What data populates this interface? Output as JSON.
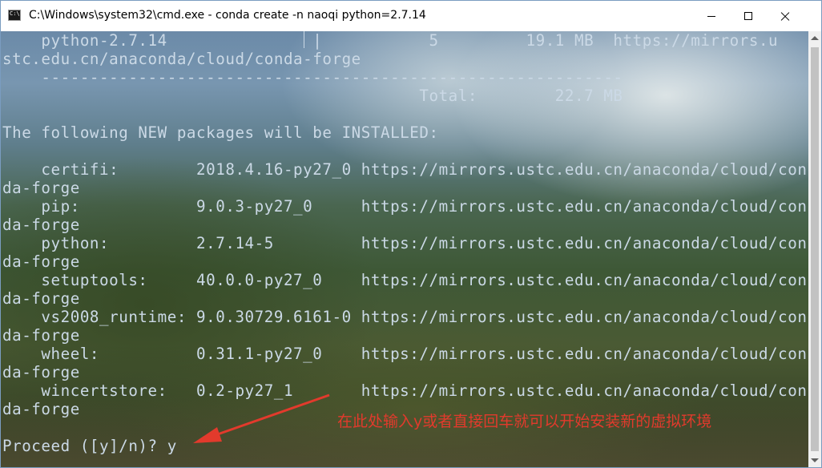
{
  "window": {
    "title": "C:\\Windows\\system32\\cmd.exe - conda  create -n naoqi python=2.7.14",
    "icon_label": "C:\\",
    "icons": [
      "cmd-app-icon",
      "minimize-icon",
      "maximize-icon",
      "close-icon"
    ]
  },
  "console": {
    "lines": [
      "    python-2.7.14               |           5         19.1 MB  https://mirrors.u",
      "stc.edu.cn/anaconda/cloud/conda-forge",
      "    ------------------------------------------------------------",
      "                                           Total:        22.7 MB",
      "",
      "The following NEW packages will be INSTALLED:",
      "",
      "    certifi:        2018.4.16-py27_0 https://mirrors.ustc.edu.cn/anaconda/cloud/con",
      "da-forge",
      "    pip:            9.0.3-py27_0     https://mirrors.ustc.edu.cn/anaconda/cloud/con",
      "da-forge",
      "    python:         2.7.14-5         https://mirrors.ustc.edu.cn/anaconda/cloud/con",
      "da-forge",
      "    setuptools:     40.0.0-py27_0    https://mirrors.ustc.edu.cn/anaconda/cloud/con",
      "da-forge",
      "    vs2008_runtime: 9.0.30729.6161-0 https://mirrors.ustc.edu.cn/anaconda/cloud/con",
      "da-forge",
      "    wheel:          0.31.1-py27_0    https://mirrors.ustc.edu.cn/anaconda/cloud/con",
      "da-forge",
      "    wincertstore:   0.2-py27_1       https://mirrors.ustc.edu.cn/anaconda/cloud/con",
      "da-forge",
      "",
      "Proceed ([y]/n)? y"
    ]
  },
  "annotation": {
    "text": "在此处输入y或者直接回车就可以开始安装新的虚拟环境",
    "color": "#e23a2c"
  },
  "colors": {
    "console_text": "#cbd9e6",
    "titlebar_bg": "#ffffff"
  }
}
